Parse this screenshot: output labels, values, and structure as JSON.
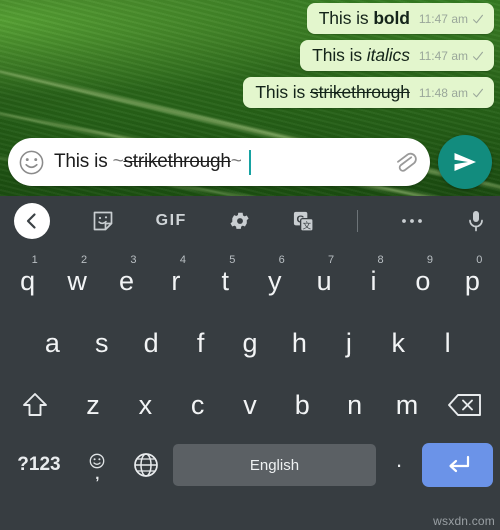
{
  "app": {
    "name": "WhatsApp chat with Android keyboard",
    "watermark": "wsxdn.com"
  },
  "chat": {
    "messages": [
      {
        "prefix": "This is ",
        "styled": "bold",
        "style": "bold",
        "time": "11:47 am",
        "status": "sent-check"
      },
      {
        "prefix": "This is ",
        "styled": "italics",
        "style": "italic",
        "time": "11:47 am",
        "status": "sent-check"
      },
      {
        "prefix": "This is ",
        "styled": "strikethrough",
        "style": "strikethrough",
        "time": "11:48 am",
        "status": "sent-check"
      }
    ],
    "bubble_color": "#e3f6cd",
    "time_color": "#9aa79a"
  },
  "composer": {
    "emoji_icon": "smiley-face-icon",
    "input_prefix": "This is ",
    "input_marker_open": "~",
    "input_styled": "strikethrough",
    "input_marker_close": "~",
    "input_full_value": "This is ~strikethrough~",
    "attach_icon": "paperclip-icon",
    "send_icon": "send-paper-plane-icon",
    "send_color": "#128c7e",
    "caret_color": "#17a2a2"
  },
  "keyboard": {
    "background": "#373d41",
    "toolbar": [
      {
        "name": "back-button",
        "icon": "chevron-left-icon",
        "label": ""
      },
      {
        "name": "sticker-button",
        "icon": "sticker-icon",
        "label": ""
      },
      {
        "name": "gif-button",
        "icon": "gif-icon",
        "label": "GIF"
      },
      {
        "name": "settings-button",
        "icon": "gear-icon",
        "label": ""
      },
      {
        "name": "translate-button",
        "icon": "translate-icon",
        "label": ""
      },
      {
        "name": "more-button",
        "icon": "ellipsis-icon",
        "label": ""
      },
      {
        "name": "voice-button",
        "icon": "microphone-icon",
        "label": ""
      }
    ],
    "row1": [
      {
        "key": "q",
        "num": "1"
      },
      {
        "key": "w",
        "num": "2"
      },
      {
        "key": "e",
        "num": "3"
      },
      {
        "key": "r",
        "num": "4"
      },
      {
        "key": "t",
        "num": "5"
      },
      {
        "key": "y",
        "num": "6"
      },
      {
        "key": "u",
        "num": "7"
      },
      {
        "key": "i",
        "num": "8"
      },
      {
        "key": "o",
        "num": "9"
      },
      {
        "key": "p",
        "num": "0"
      }
    ],
    "row2": [
      {
        "key": "a"
      },
      {
        "key": "s"
      },
      {
        "key": "d"
      },
      {
        "key": "f"
      },
      {
        "key": "g"
      },
      {
        "key": "h"
      },
      {
        "key": "j"
      },
      {
        "key": "k"
      },
      {
        "key": "l"
      }
    ],
    "row3": [
      {
        "key": "z"
      },
      {
        "key": "x"
      },
      {
        "key": "c"
      },
      {
        "key": "v"
      },
      {
        "key": "b"
      },
      {
        "key": "n"
      },
      {
        "key": "m"
      }
    ],
    "shift_icon": "shift-up-arrow-icon",
    "backspace_icon": "backspace-delete-icon",
    "row4": {
      "symbols_label": "?123",
      "emoji_icon": "emoji-smiley-icon",
      "comma_label": ",",
      "globe_icon": "language-globe-icon",
      "space_label": "English",
      "period_label": ".",
      "enter_icon": "enter-return-arrow-icon",
      "enter_color": "#6b93e8",
      "space_color": "#5b6064"
    }
  }
}
